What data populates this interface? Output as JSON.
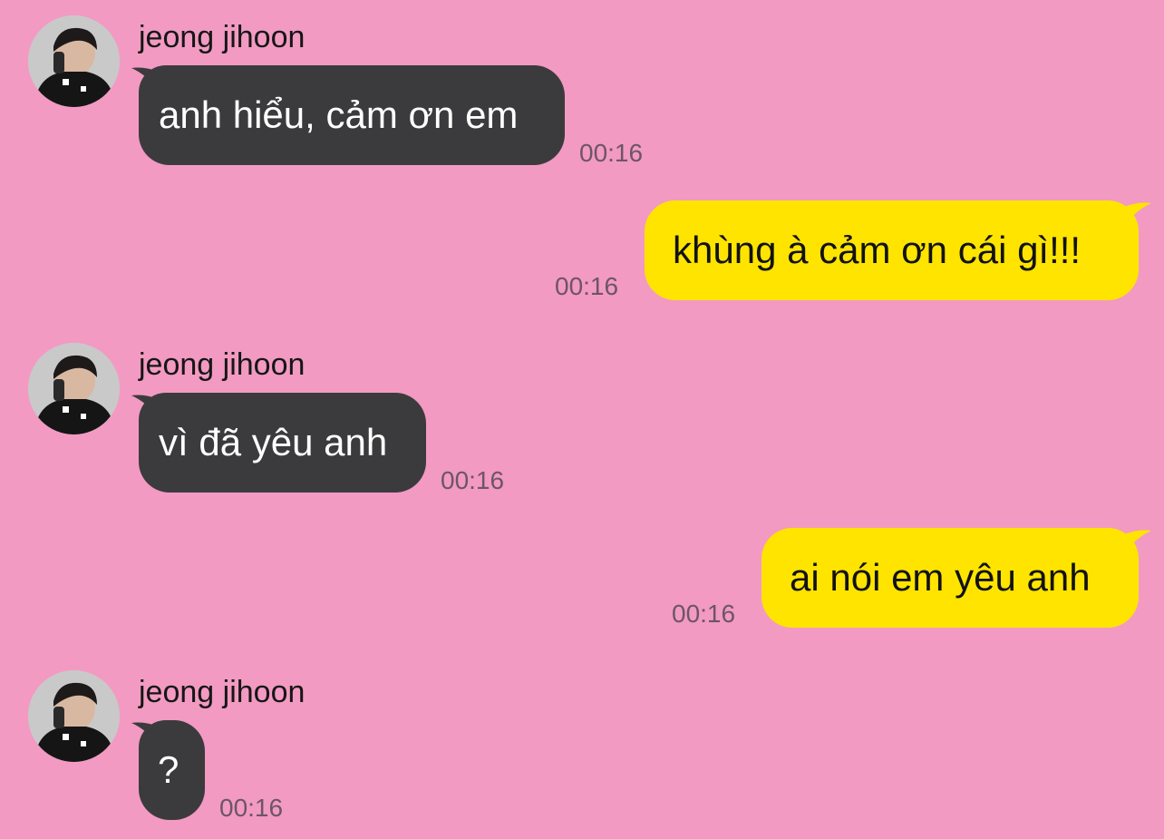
{
  "theme": {
    "background": "#f29ac2",
    "incoming_bubble": "#3b3b3d",
    "outgoing_bubble": "#ffe400",
    "timestamp_color": "#6e5565"
  },
  "messages": [
    {
      "direction": "incoming",
      "sender": "jeong jihoon",
      "avatar_icon": "profile-photo",
      "text": "anh hiểu, cảm ơn em",
      "time": "00:16"
    },
    {
      "direction": "outgoing",
      "text": "khùng à cảm ơn cái gì!!!",
      "time": "00:16"
    },
    {
      "direction": "incoming",
      "sender": "jeong jihoon",
      "avatar_icon": "profile-photo",
      "text": "vì đã yêu anh",
      "time": "00:16"
    },
    {
      "direction": "outgoing",
      "text": "ai nói em yêu anh",
      "time": "00:16"
    },
    {
      "direction": "incoming",
      "sender": "jeong jihoon",
      "avatar_icon": "profile-photo",
      "text": "?",
      "time": "00:16"
    }
  ]
}
